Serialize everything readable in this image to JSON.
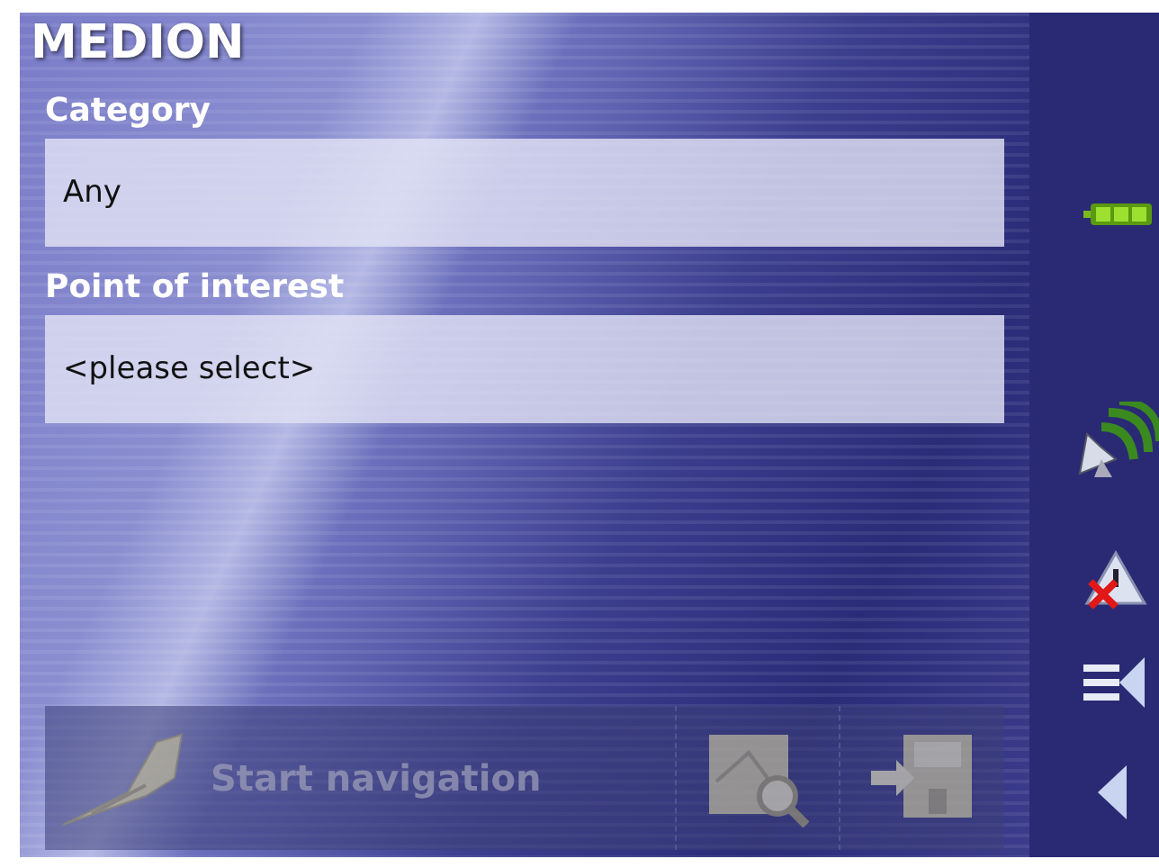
{
  "logo": "MEDION",
  "fields": [
    {
      "label": "Category",
      "value": "Any"
    },
    {
      "label": "Point of interest",
      "value": "<please select>"
    }
  ],
  "toolbar": [
    {
      "kind": "start",
      "label": "Start navigation",
      "disabled": true
    },
    {
      "kind": "map",
      "disabled": true
    },
    {
      "kind": "save",
      "disabled": true
    }
  ],
  "sidebar": [
    {
      "kind": "battery"
    },
    {
      "kind": "gps"
    },
    {
      "kind": "warning"
    },
    {
      "kind": "menu"
    },
    {
      "kind": "back"
    }
  ]
}
